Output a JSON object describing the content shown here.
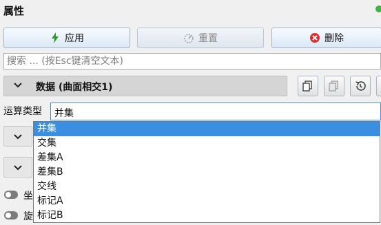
{
  "panel": {
    "title": "属性"
  },
  "toolbar": {
    "apply": "应用",
    "reset": "重置",
    "delete": "删除"
  },
  "search": {
    "placeholder": "搜索 ... (按Esc键清空文本)"
  },
  "section": {
    "title": "数据 (曲面相交1)"
  },
  "operation": {
    "label": "运算类型",
    "value": "并集",
    "options": [
      "并集",
      "交集",
      "差集A",
      "差集B",
      "交线",
      "标记A",
      "标记B"
    ]
  },
  "toggles": [
    {
      "label": "坐"
    },
    {
      "label": "旋"
    }
  ],
  "colors": {
    "accent": "#3b8fe0",
    "apply_icon": "#2e9c2e",
    "delete_icon": "#d9302c",
    "status_dot": "#3fb43f"
  }
}
